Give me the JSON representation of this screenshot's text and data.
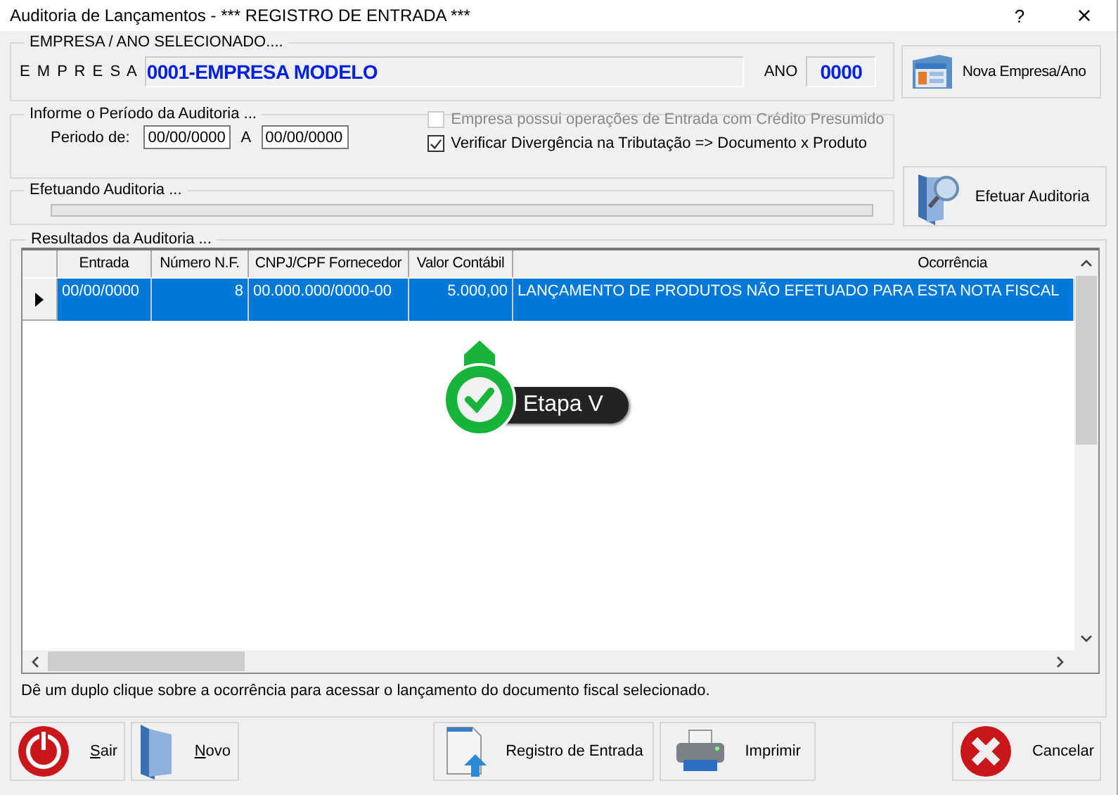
{
  "window": {
    "title": "Auditoria de Lançamentos - *** REGISTRO DE ENTRADA ***",
    "help": "?",
    "close": "×"
  },
  "empresa_group": {
    "legend": "EMPRESA  /  ANO  SELECIONADO....",
    "empresa_label": "E M P R E S A",
    "empresa_value": "0001-EMPRESA MODELO",
    "ano_label": "ANO",
    "ano_value": "0000"
  },
  "nova_button": {
    "label": "Nova Empresa/Ano"
  },
  "periodo_group": {
    "legend": "Informe o Período da Auditoria  ...",
    "periodo_label": "Periodo de:",
    "from_value": "00/00/0000",
    "separator": "A",
    "to_value": "00/00/0000",
    "options": [
      {
        "label": "Empresa possui operações de Entrada com Crédito Presumido",
        "checked": false,
        "disabled": true
      },
      {
        "label": "Verificar Divergência na Tributação => Documento x Produto",
        "checked": true,
        "disabled": false
      }
    ]
  },
  "progress_group": {
    "legend": "Efetuando Auditoria ...",
    "level": 0
  },
  "efetuar_button": {
    "label": "Efetuar Auditoria"
  },
  "results_group": {
    "legend": "Resultados da Auditoria ...",
    "table": {
      "columns": [
        "Entrada",
        "Número N.F.",
        "CNPJ/CPF Fornecedor",
        "Valor Contábil",
        "Ocorrência"
      ],
      "rows": [
        {
          "selected": true,
          "cells": [
            "00/00/0000",
            "8",
            "00.000.000/0000-00",
            "5.000,00",
            "LANÇAMENTO DE PRODUTOS NÃO EFETUADO PARA ESTA NOTA FISCAL"
          ]
        }
      ]
    },
    "hint": "Dê um duplo clique sobre a ocorrência para acessar o lançamento do documento fiscal selecionado."
  },
  "overlay": {
    "label": "Etapa V"
  },
  "buttons": [
    {
      "kind": "power",
      "label": "Sair",
      "underline_first": true
    },
    {
      "kind": "folder",
      "label": "Novo",
      "underline_first": true
    },
    {
      "kind": "document",
      "label": "Registro de Entrada",
      "underline_first": false
    },
    {
      "kind": "printer",
      "label": "Imprimir",
      "underline_first": false
    },
    {
      "kind": "cancel",
      "label": "Cancelar",
      "underline_first": false
    }
  ]
}
